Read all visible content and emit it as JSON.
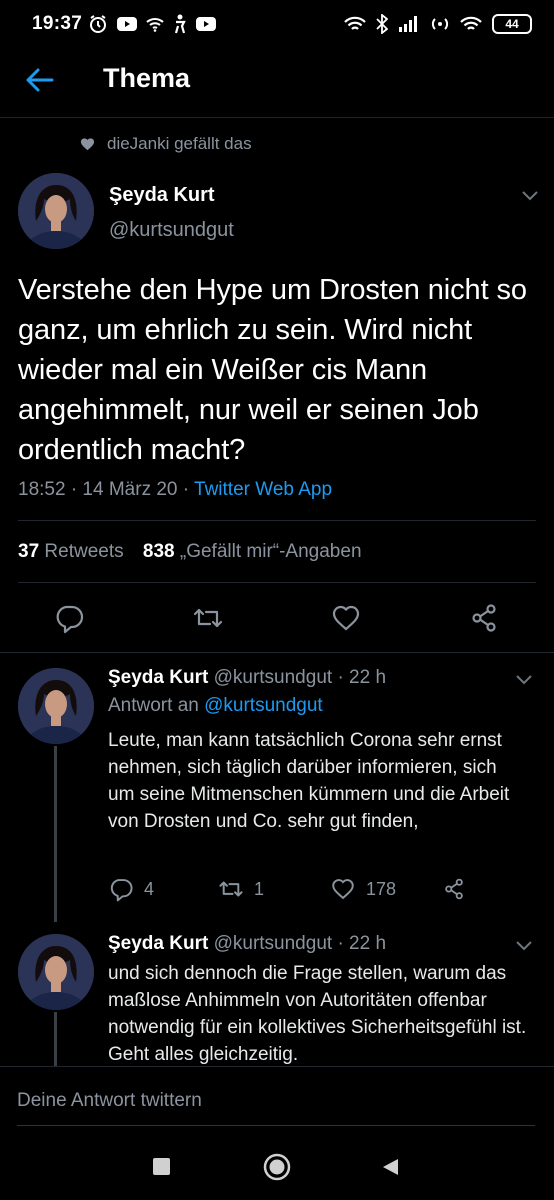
{
  "status_bar": {
    "time": "19:37",
    "battery": "44"
  },
  "header": {
    "title": "Thema"
  },
  "liked_by": "dieJanki gefällt das",
  "main_tweet": {
    "name": "Şeyda Kurt",
    "handle": "@kurtsundgut",
    "text": "Verstehe den Hype um Drosten nicht so ganz, um ehrlich zu sein. Wird nicht wieder mal ein Weißer cis Mann angehimmelt, nur weil er seinen Job ordentlich macht?",
    "timestamp": "18:52 · 14 März 20 · ",
    "source": "Twitter Web App",
    "retweets_count": "37",
    "retweets_label": " Retweets",
    "likes_count": "838",
    "likes_label": " „Gefällt mir“-Angaben"
  },
  "replies": [
    {
      "name": "Şeyda Kurt",
      "handle": " @kurtsundgut · 22 h",
      "reply_to_label": "Antwort an ",
      "reply_to_handle": "@kurtsundgut",
      "text": "Leute, man kann tatsächlich Corona sehr ernst nehmen, sich täglich darüber informieren, sich um seine Mitmenschen kümmern und die Arbeit von Drosten und Co. sehr gut finden,",
      "replies": "4",
      "retweets": "1",
      "likes": "178"
    },
    {
      "name": "Şeyda Kurt",
      "handle": " @kurtsundgut · 22 h",
      "text": "und sich dennoch die Frage stellen, warum das maßlose Anhimmeln von Autoritäten offenbar notwendig für ein kollektives Sicherheitsgefühl ist. Geht alles gleichzeitig."
    }
  ],
  "reply_box": {
    "placeholder": "Deine Antwort twittern"
  },
  "colors": {
    "accent": "#1d9bf0",
    "background": "#000000",
    "muted": "#8b949e"
  }
}
